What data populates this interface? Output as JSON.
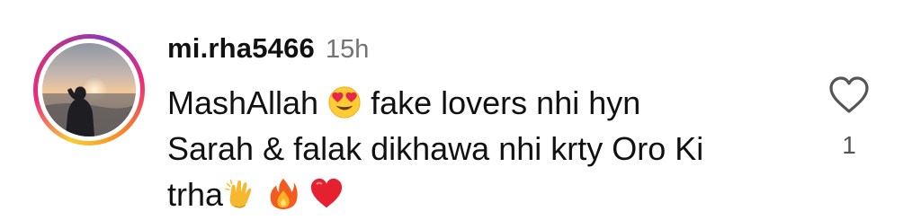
{
  "comment": {
    "username": "mi.rha5466",
    "time": "15h",
    "text_line1_a": "MashAllah ",
    "text_line1_b": " fake lovers nhi hyn",
    "text_line2": "Sarah & falak dikhawa nhi krty Oro Ki",
    "text_line3": "trha",
    "emojis": [
      "heart-eyes-emoji",
      "clapping-hands-emoji",
      "fire-emoji",
      "red-heart-emoji"
    ],
    "like_count": "1"
  },
  "colors": {
    "ring_gradient": [
      "#f9ce34",
      "#ee2a7b",
      "#c13584",
      "#8a3ab9",
      "#f58529"
    ],
    "text": "#111111",
    "muted": "#737373"
  },
  "icons": {
    "like": "heart-outline-icon"
  }
}
